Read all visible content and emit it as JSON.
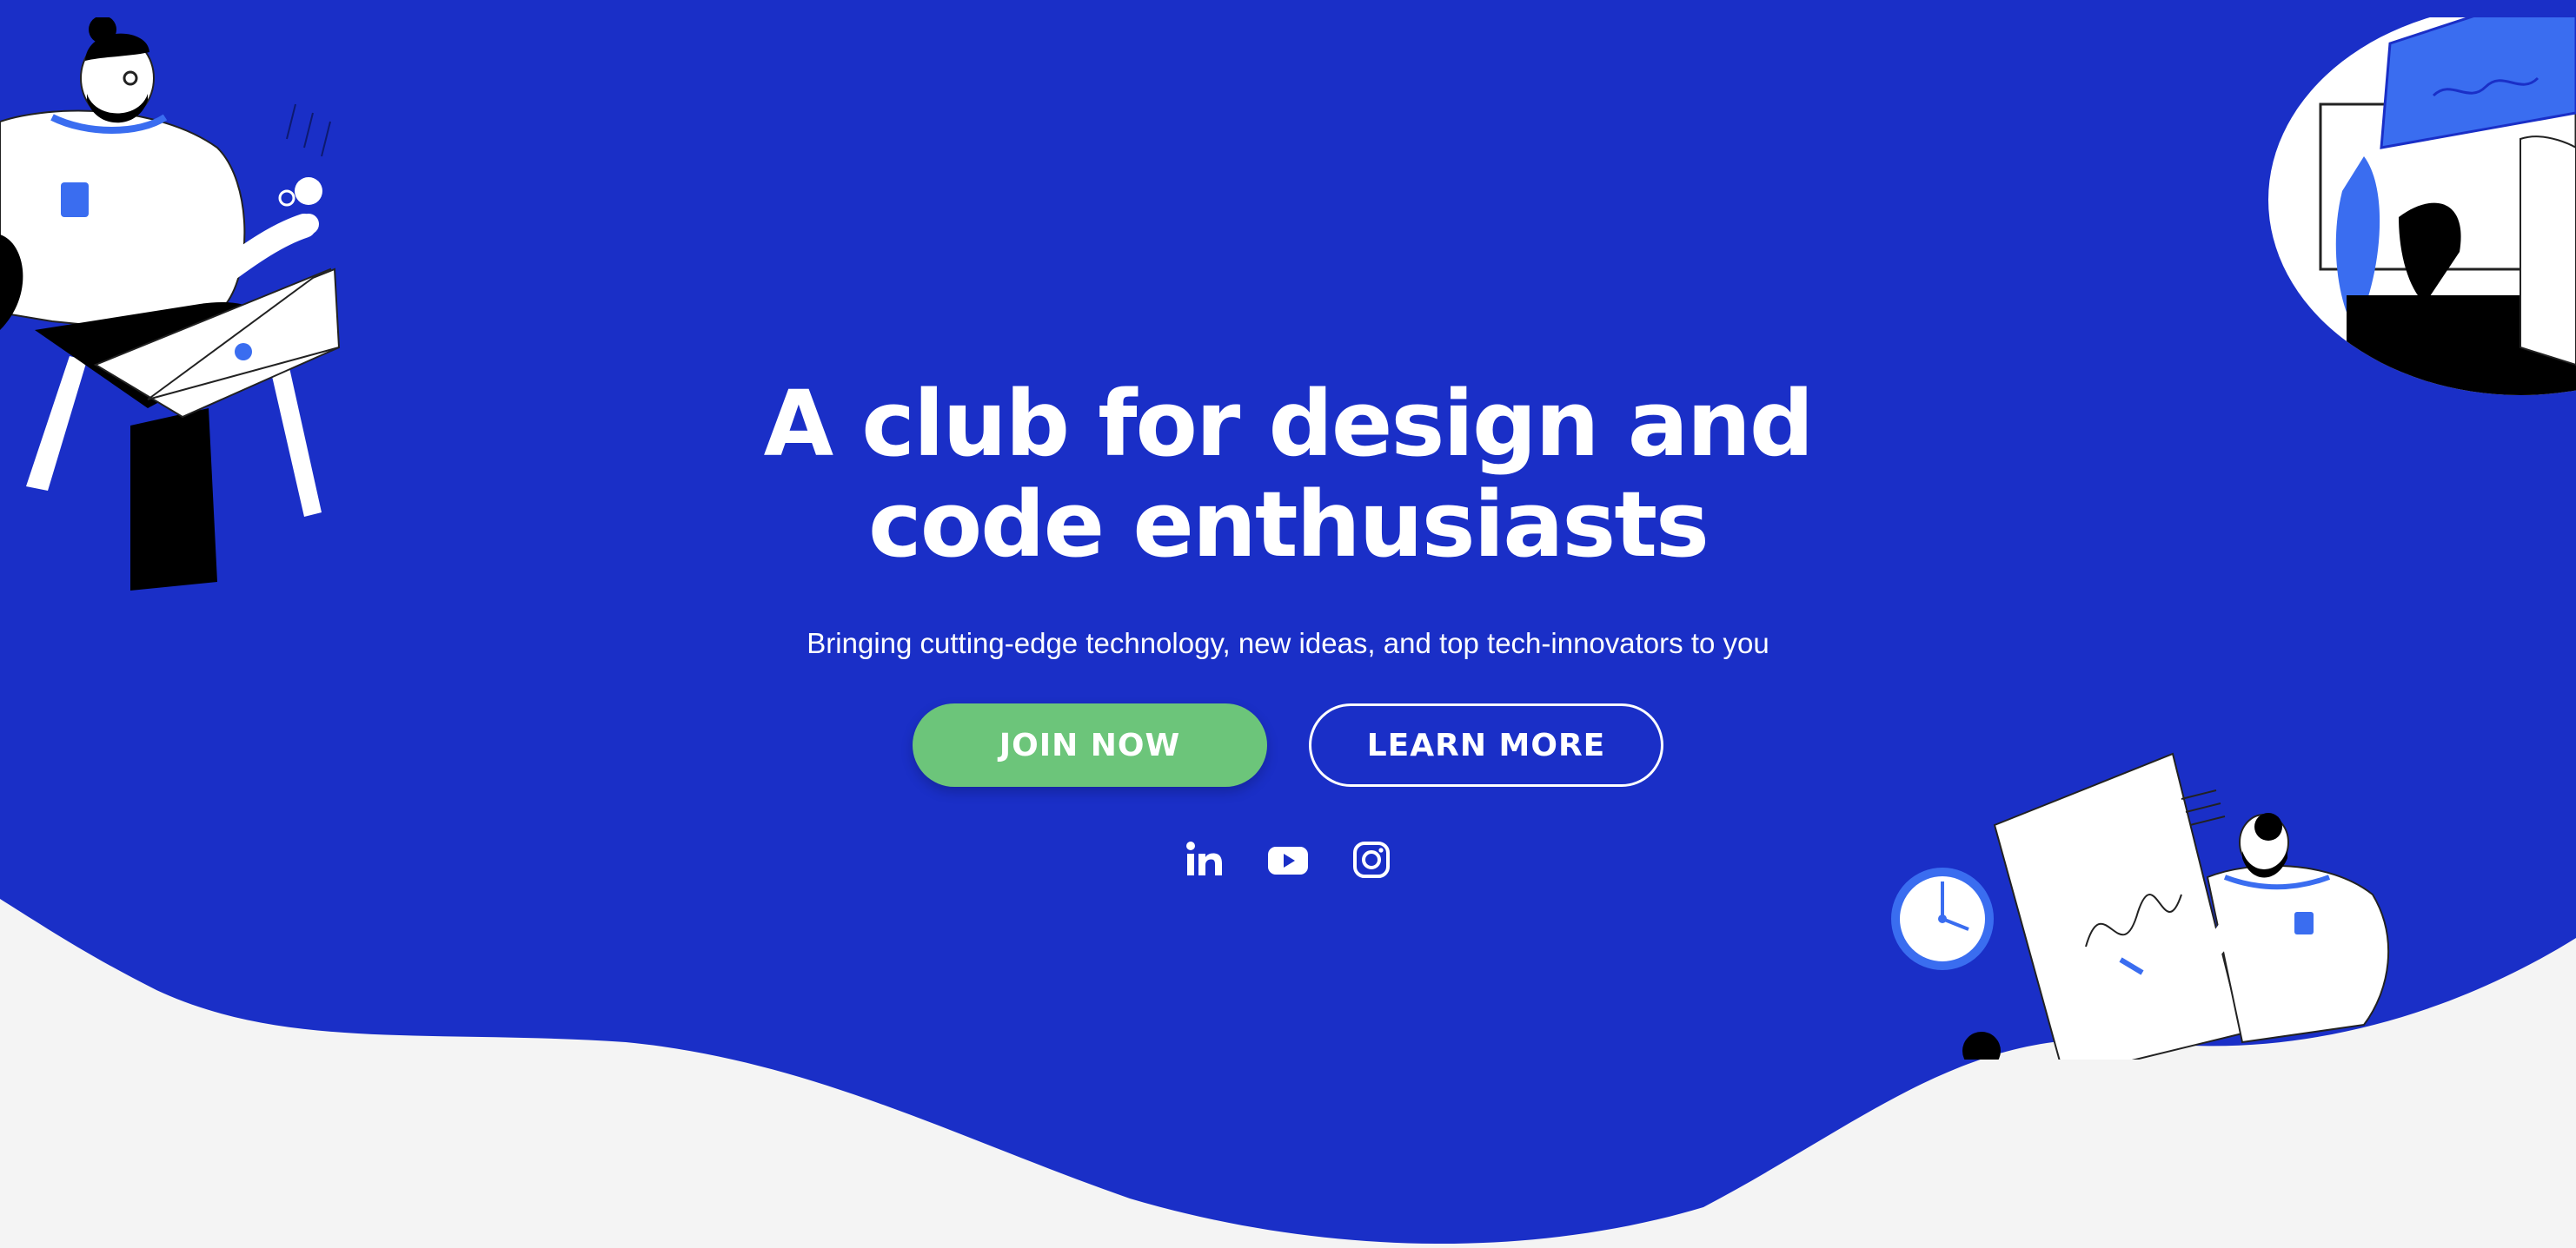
{
  "hero": {
    "headline_line1": "A club for design and",
    "headline_line2": "code enthusiasts",
    "subtitle": "Bringing cutting-edge technology, new ideas, and top tech-innovators to you",
    "join_label": "JOIN NOW",
    "learn_label": "LEARN MORE"
  },
  "socials": [
    {
      "icon": "linkedin-icon"
    },
    {
      "icon": "youtube-icon"
    },
    {
      "icon": "instagram-icon"
    }
  ],
  "colors": {
    "hero_blue": "#1a2fc7",
    "accent_blue": "#3a6df0",
    "join_green": "#6cc57a",
    "page_bg": "#f4f4f4"
  }
}
